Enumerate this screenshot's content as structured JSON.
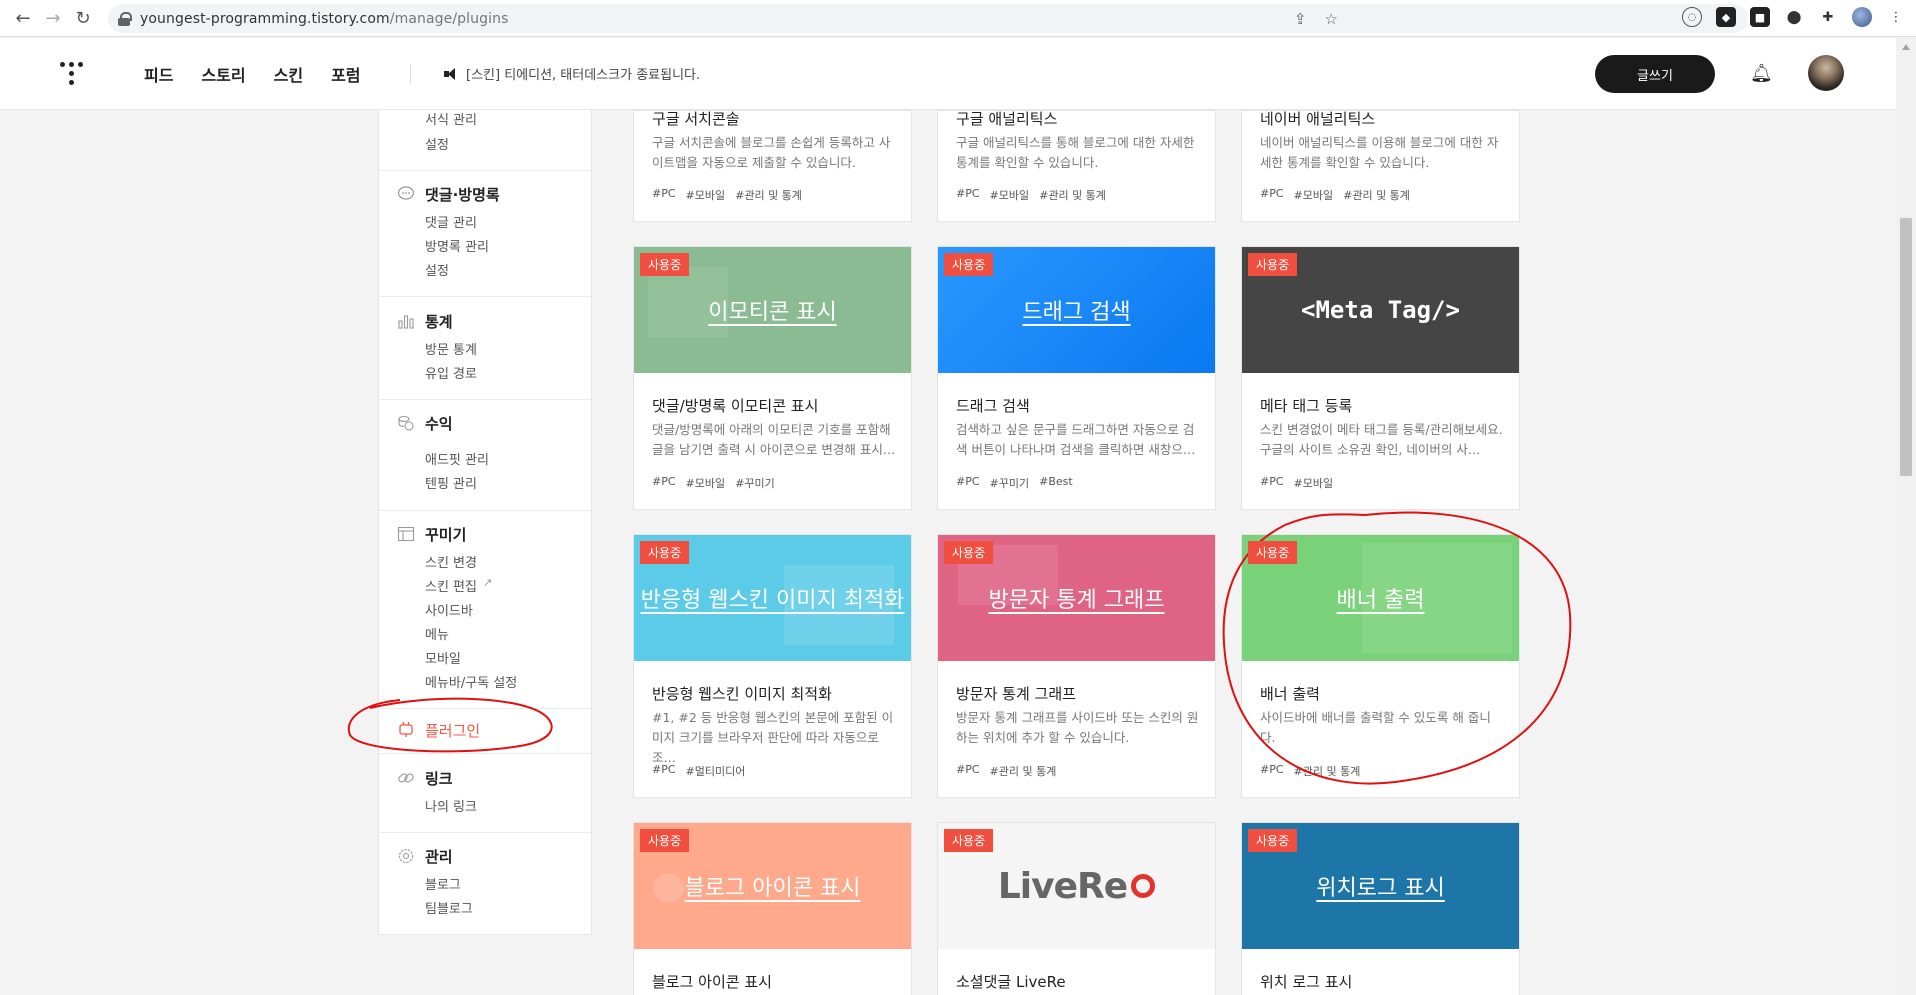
{
  "browser": {
    "url_host": "youngest-programming.tistory.com",
    "url_path": "/manage/plugins"
  },
  "header": {
    "nav": [
      "피드",
      "스토리",
      "스킨",
      "포럼"
    ],
    "notice": "[스킨] 티에디션, 태터데스크가 종료됩니다.",
    "write_label": "글쓰기"
  },
  "sidebar": {
    "top_items": [
      "서식 관리",
      "설정"
    ],
    "groups": [
      {
        "title": "댓글·방명록",
        "icon": "comment-icon",
        "items": [
          "댓글 관리",
          "방명록 관리",
          "설정"
        ]
      },
      {
        "title": "통계",
        "icon": "chart-icon",
        "items": [
          "방문 통계",
          "유입 경로"
        ]
      },
      {
        "title": "수익",
        "icon": "coins-icon",
        "items": [
          "애드핏 관리",
          "텐핑 관리"
        ]
      },
      {
        "title": "꾸미기",
        "icon": "layout-icon",
        "items": [
          "스킨 변경",
          "스킨 편집",
          "사이드바",
          "메뉴",
          "모바일",
          "메뉴바/구독 설정"
        ]
      },
      {
        "title": "플러그인",
        "icon": "plug-icon",
        "items": []
      },
      {
        "title": "링크",
        "icon": "link-icon",
        "items": [
          "나의 링크"
        ]
      },
      {
        "title": "관리",
        "icon": "gear-icon",
        "items": [
          "블로그",
          "팀블로그"
        ]
      }
    ]
  },
  "badge_label": "사용중",
  "cards": [
    {
      "thumb": "",
      "title": "구글 서치콘솔",
      "desc": "구글 서치콘솔에 블로그를 손쉽게 등록하고 사이트맵을 자동으로 제출할 수 있습니다.",
      "tags": [
        "#PC",
        "#모바일",
        "#관리 및 통계"
      ]
    },
    {
      "thumb": "",
      "title": "구글 애널리틱스",
      "desc": "구글 애널리틱스를 통해 블로그에 대한 자세한 통계를 확인할 수 있습니다.",
      "tags": [
        "#PC",
        "#모바일",
        "#관리 및 통계"
      ]
    },
    {
      "thumb": "",
      "title": "네이버 애널리틱스",
      "desc": "네이버 애널리틱스를 이용해 블로그에 대한 자세한 통계를 확인할 수 있습니다.",
      "tags": [
        "#PC",
        "#모바일",
        "#관리 및 통계"
      ]
    },
    {
      "thumb": "이모티콘 표시",
      "title": "댓글/방명록 이모티콘 표시",
      "desc": "댓글/방명록에 아래의 이모티콘 기호를 포함해 글을 남기면 출력 시 아이콘으로 변경해 표시…",
      "tags": [
        "#PC",
        "#모바일",
        "#꾸미기"
      ],
      "color": "#8bbb92"
    },
    {
      "thumb": "드래그 검색",
      "title": "드래그 검색",
      "desc": "검색하고 싶은 문구를 드래그하면 자동으로 검색 버튼이 나타나며 검색을 클릭하면 새창으…",
      "tags": [
        "#PC",
        "#꾸미기",
        "#Best"
      ],
      "color": "#1a8cff"
    },
    {
      "thumb": "<Meta Tag/>",
      "title": "메타 태그 등록",
      "desc": "스킨 변경없이 메타 태그를 등록/관리해보세요. 구글의 사이트 소유권 확인, 네이버의 사…",
      "tags": [
        "#PC",
        "#모바일"
      ],
      "color": "#454545"
    },
    {
      "thumb": "반응형 웹스킨 이미지 최적화",
      "title": "반응형 웹스킨 이미지 최적화",
      "desc": "#1, #2 등 반응형 웹스킨의 본문에 포함된 이미지 크기를 브라우저 판단에 따라 자동으로 조…",
      "tags": [
        "#PC",
        "#멀티미디어"
      ],
      "color": "#5ccbe8"
    },
    {
      "thumb": "방문자 통계 그래프",
      "title": "방문자 통계 그래프",
      "desc": "방문자 통계 그래프를 사이드바 또는 스킨의 원하는 위치에 추가 할 수 있습니다.",
      "tags": [
        "#PC",
        "#관리 및 통계"
      ],
      "color": "#df6385"
    },
    {
      "thumb": "배너 출력",
      "title": "배너 출력",
      "desc": "사이드바에 배너를 출력할 수 있도록 해 줍니다.",
      "tags": [
        "#PC",
        "#관리 및 통계"
      ],
      "color": "#79d279"
    },
    {
      "thumb": "블로그 아이콘 표시",
      "title": "블로그 아이콘 표시",
      "desc": "",
      "tags": [],
      "color": "#ffa98c"
    },
    {
      "thumb": "LiveRe",
      "title": "소셜댓글 LiveRe",
      "desc": "",
      "tags": [],
      "color": "#f5f5f5"
    },
    {
      "thumb": "위치로그 표시",
      "title": "위치 로그 표시",
      "desc": "",
      "tags": [],
      "color": "#1e76a8"
    }
  ]
}
